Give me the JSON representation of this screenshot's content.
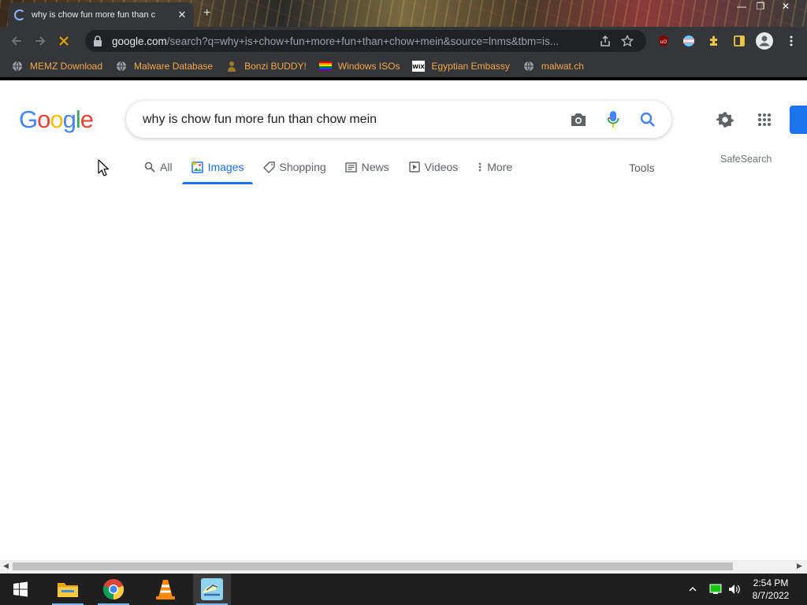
{
  "browser": {
    "tab": {
      "title": "why is chow fun more fun than chow mein - Google Search",
      "visible_title": "why is chow fun more fun than c"
    },
    "window_controls": {
      "minimize": "—",
      "restore": "❐",
      "close": "✕"
    },
    "url_host": "google.com",
    "url_path": "/search?q=why+is+chow+fun+more+fun+than+chow+mein&source=lnms&tbm=is...",
    "bookmarks": [
      {
        "label": "MEMZ Download",
        "icon": "globe-icon"
      },
      {
        "label": "Malware Database",
        "icon": "globe-icon"
      },
      {
        "label": "Bonzi BUDDY!",
        "icon": "bonzi-icon"
      },
      {
        "label": "Windows ISOs",
        "icon": "rainbow-flag-icon"
      },
      {
        "label": "Egyptian Embassy",
        "icon": "wix-icon"
      },
      {
        "label": "malwat.ch",
        "icon": "globe-icon"
      }
    ]
  },
  "google": {
    "logo": [
      "G",
      "o",
      "o",
      "g",
      "l",
      "e"
    ],
    "query": "why is chow fun more fun than chow mein",
    "tabs": [
      {
        "label": "All",
        "icon": "search-icon"
      },
      {
        "label": "Images",
        "icon": "image-icon",
        "active": true
      },
      {
        "label": "Shopping",
        "icon": "tag-icon"
      },
      {
        "label": "News",
        "icon": "news-icon"
      },
      {
        "label": "Videos",
        "icon": "video-icon"
      },
      {
        "label": "More",
        "icon": "more-vert-icon"
      }
    ],
    "tools": "Tools",
    "safesearch": "SafeSearch",
    "colors": {
      "blue": "#4285F4",
      "red": "#EA4335",
      "yellow": "#FBBC05",
      "green": "#34A853",
      "accent": "#1a73e8"
    }
  },
  "taskbar": {
    "clock_time": "2:54 PM",
    "clock_date": "8/7/2022",
    "apps": [
      "start-icon",
      "file-explorer-icon",
      "chrome-icon",
      "vlc-icon",
      "app-icon"
    ]
  }
}
